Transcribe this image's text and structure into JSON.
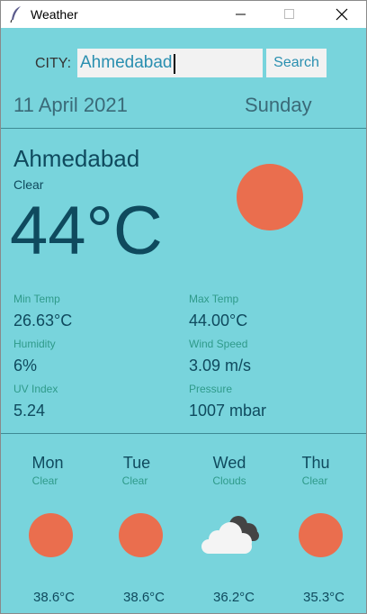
{
  "window": {
    "title": "Weather"
  },
  "search": {
    "label": "CITY:",
    "value": "Ahmedabad",
    "button": "Search"
  },
  "header": {
    "date": "11 April 2021",
    "day": "Sunday"
  },
  "current": {
    "city": "Ahmedabad",
    "condition": "Clear",
    "temperature": "44°C",
    "icon": "sun-icon"
  },
  "stats": [
    {
      "label": "Min Temp",
      "value": "26.63°C"
    },
    {
      "label": "Max Temp",
      "value": "44.00°C"
    },
    {
      "label": "Humidity",
      "value": "6%"
    },
    {
      "label": "Wind Speed",
      "value": "3.09 m/s"
    },
    {
      "label": "UV Index",
      "value": "5.24"
    },
    {
      "label": "Pressure",
      "value": "1007 mbar"
    }
  ],
  "forecast": [
    {
      "day": "Mon",
      "condition": "Clear",
      "temp": "38.6°C",
      "icon": "sun-icon"
    },
    {
      "day": "Tue",
      "condition": "Clear",
      "temp": "38.6°C",
      "icon": "sun-icon"
    },
    {
      "day": "Wed",
      "condition": "Clouds",
      "temp": "36.2°C",
      "icon": "cloud-icon"
    },
    {
      "day": "Thu",
      "condition": "Clear",
      "temp": "35.3°C",
      "icon": "sun-icon"
    }
  ],
  "colors": {
    "background": "#78d4dc",
    "sun": "#ea6e4e",
    "text_dark": "#0f4a5e",
    "label": "#2f9a8a",
    "accent": "#2a8fb0"
  }
}
